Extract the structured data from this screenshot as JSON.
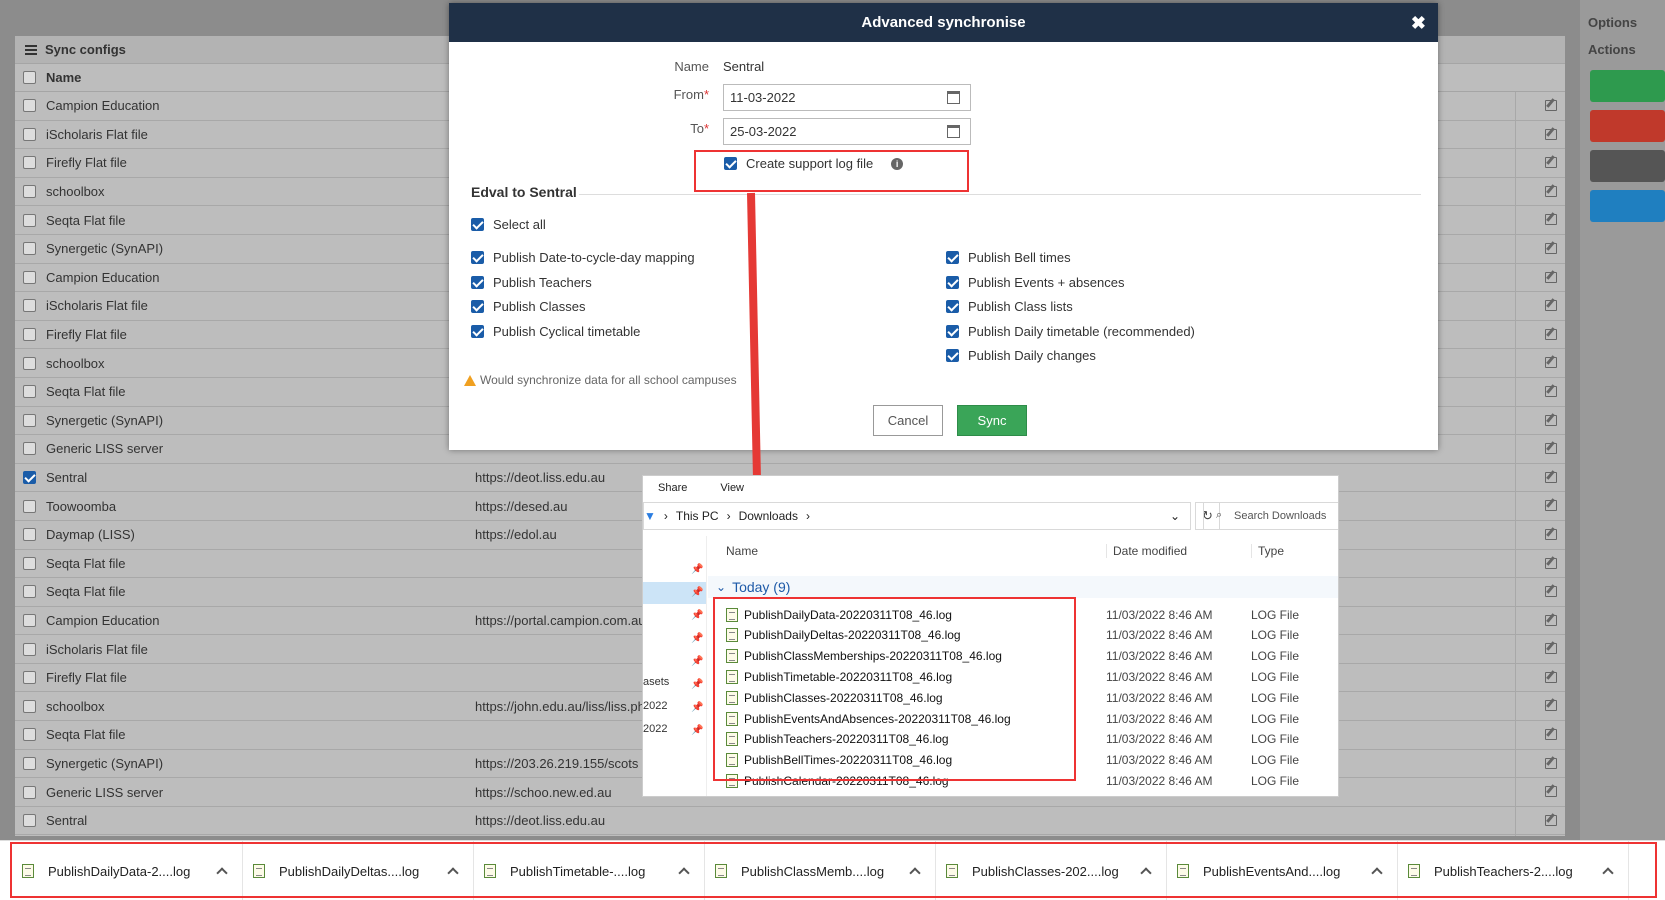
{
  "background": {
    "panel_title": "Sync configs",
    "column_name": "Name",
    "rows": [
      {
        "name": "Campion Education",
        "url": "",
        "checked": false
      },
      {
        "name": "iScholaris Flat file",
        "url": "",
        "checked": false
      },
      {
        "name": "Firefly Flat file",
        "url": "",
        "checked": false
      },
      {
        "name": "schoolbox",
        "url": "",
        "checked": false
      },
      {
        "name": "Seqta Flat file",
        "url": "",
        "checked": false
      },
      {
        "name": "Synergetic (SynAPI)",
        "url": "",
        "checked": false
      },
      {
        "name": "Campion Education",
        "url": "",
        "checked": false
      },
      {
        "name": "iScholaris Flat file",
        "url": "",
        "checked": false
      },
      {
        "name": "Firefly Flat file",
        "url": "",
        "checked": false
      },
      {
        "name": "schoolbox",
        "url": "",
        "checked": false
      },
      {
        "name": "Seqta Flat file",
        "url": "",
        "checked": false
      },
      {
        "name": "Synergetic (SynAPI)",
        "url": "",
        "checked": false
      },
      {
        "name": "Generic LISS server",
        "url": "",
        "checked": false
      },
      {
        "name": "Sentral",
        "url": "https://deot.liss.edu.au",
        "checked": true
      },
      {
        "name": "Toowoomba",
        "url": "https://desed.au",
        "checked": false
      },
      {
        "name": "Daymap (LISS)",
        "url": "https://edol.au",
        "checked": false
      },
      {
        "name": "Seqta Flat file",
        "url": "",
        "checked": false
      },
      {
        "name": "Seqta Flat file",
        "url": "",
        "checked": false
      },
      {
        "name": "Campion Education",
        "url": "https://portal.campion.com.au",
        "checked": false
      },
      {
        "name": "iScholaris Flat file",
        "url": "",
        "checked": false
      },
      {
        "name": "Firefly Flat file",
        "url": "",
        "checked": false
      },
      {
        "name": "schoolbox",
        "url": "https://john.edu.au/liss/liss.ph",
        "checked": false
      },
      {
        "name": "Seqta Flat file",
        "url": "",
        "checked": false
      },
      {
        "name": "Synergetic (SynAPI)",
        "url": "https://203.26.219.155/scots",
        "checked": false
      },
      {
        "name": "Generic LISS server",
        "url": "https://schoo.new.ed.au",
        "checked": false
      },
      {
        "name": "Sentral",
        "url": "https://deot.liss.edu.au",
        "checked": false
      }
    ],
    "right": {
      "options": "Options",
      "actions": "Actions"
    },
    "action_colors": [
      "#2e9a4e",
      "#c0392b",
      "#555555",
      "#1f7fc0"
    ]
  },
  "modal": {
    "title": "Advanced synchronise",
    "name_label": "Name",
    "name_value": "Sentral",
    "from_label": "From",
    "from_value": "11-03-2022",
    "to_label": "To",
    "to_value": "25-03-2022",
    "support_log_label": "Create support log file",
    "section_title": "Edval to Sentral",
    "select_all": "Select all",
    "left_options": [
      "Publish Date-to-cycle-day mapping",
      "Publish Teachers",
      "Publish Classes",
      "Publish Cyclical timetable"
    ],
    "right_options": [
      "Publish Bell times",
      "Publish Events + absences",
      "Publish Class lists",
      "Publish Daily timetable (recommended)",
      "Publish Daily changes"
    ],
    "warning": "Would synchronize data for all school campuses",
    "cancel": "Cancel",
    "sync": "Sync"
  },
  "explorer": {
    "tabs": [
      "Share",
      "View"
    ],
    "breadcrumb": [
      "This PC",
      "Downloads"
    ],
    "search_placeholder": "Search Downloads",
    "nav_fragments": [
      "asets",
      "2022",
      "2022"
    ],
    "columns": {
      "name": "Name",
      "date": "Date modified",
      "type": "Type"
    },
    "group": "Today (9)",
    "files": [
      {
        "name": "PublishDailyData-20220311T08_46.log",
        "date": "11/03/2022 8:46 AM",
        "type": "LOG File"
      },
      {
        "name": "PublishDailyDeltas-20220311T08_46.log",
        "date": "11/03/2022 8:46 AM",
        "type": "LOG File"
      },
      {
        "name": "PublishClassMemberships-20220311T08_46.log",
        "date": "11/03/2022 8:46 AM",
        "type": "LOG File"
      },
      {
        "name": "PublishTimetable-20220311T08_46.log",
        "date": "11/03/2022 8:46 AM",
        "type": "LOG File"
      },
      {
        "name": "PublishClasses-20220311T08_46.log",
        "date": "11/03/2022 8:46 AM",
        "type": "LOG File"
      },
      {
        "name": "PublishEventsAndAbsences-20220311T08_46.log",
        "date": "11/03/2022 8:46 AM",
        "type": "LOG File"
      },
      {
        "name": "PublishTeachers-20220311T08_46.log",
        "date": "11/03/2022 8:46 AM",
        "type": "LOG File"
      },
      {
        "name": "PublishBellTimes-20220311T08_46.log",
        "date": "11/03/2022 8:46 AM",
        "type": "LOG File"
      },
      {
        "name": "PublishCalendar-20220311T08_46.log",
        "date": "11/03/2022 8:46 AM",
        "type": "LOG File"
      }
    ]
  },
  "downloads": [
    "PublishDailyData-2....log",
    "PublishDailyDeltas....log",
    "PublishTimetable-....log",
    "PublishClassMemb....log",
    "PublishClasses-202....log",
    "PublishEventsAnd....log",
    "PublishTeachers-2....log"
  ],
  "colors": {
    "modal_header": "#1f3047",
    "sync_button": "#3aa558",
    "annotation": "#e53935"
  }
}
